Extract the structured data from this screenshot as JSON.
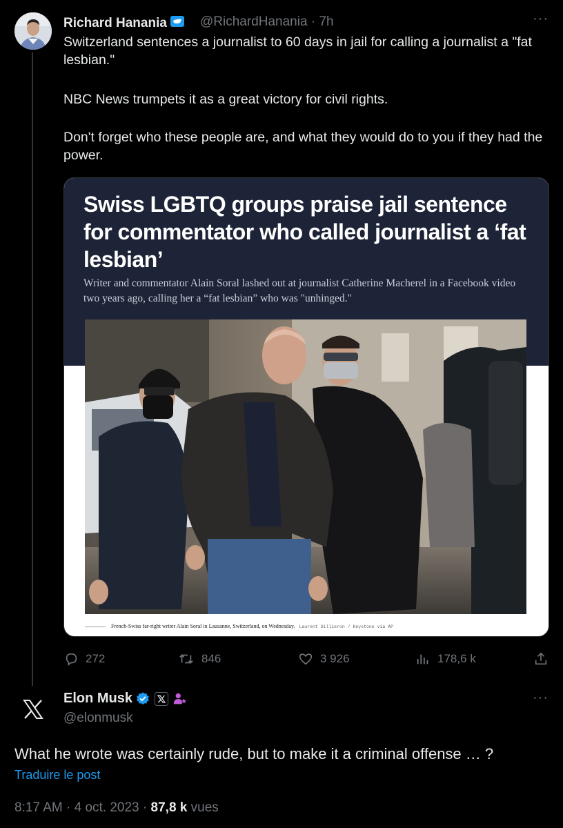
{
  "tweet": {
    "author_name": "Richard Hanania",
    "author_handle": "@RichardHanania",
    "separator": "·",
    "age": "7h",
    "more": "···",
    "text_line1": "Switzerland sentences a journalist to 60 days in jail for calling a journalist a \"fat lesbian.\"",
    "text_line2": "NBC News trumpets it as a great victory for civil rights.",
    "text_line3": "Don't forget who these people are, and what they would do to you if they had the power.",
    "card": {
      "headline": "Swiss LGBTQ groups praise jail sentence for commentator who called journalist a ‘fat lesbian’",
      "dek": "Writer and commentator Alain Soral lashed out at journalist Catherine Macherel in a Facebook video two years ago, calling her a “fat lesbian” who was \"unhinged.\"",
      "caption": "French-Swiss far-right writer Alain Soral in Lausanne, Switzerland, on Wednesday.",
      "credit": "Laurent Gillieron / Keystone via AP"
    },
    "stats": {
      "replies": "272",
      "retweets": "846",
      "likes": "3 926",
      "views": "178,6 k"
    }
  },
  "reply": {
    "author_name": "Elon Musk",
    "author_handle": "@elonmusk",
    "more": "···",
    "text": "What he wrote was certainly rude, but to make it a criminal offense … ?",
    "translate_label": "Traduire le post",
    "time": "8:17 AM",
    "date": "4 oct. 2023",
    "dot": "·",
    "views_count": "87,8 k",
    "views_label": "vues"
  },
  "colors": {
    "background": "#000000",
    "text": "#e7e9ea",
    "muted": "#71767b",
    "accent": "#1d9bf0",
    "card_header": "#1e2437"
  },
  "icons": [
    "verified-badge-icon",
    "more-icon",
    "reply-icon",
    "retweet-icon",
    "like-icon",
    "views-icon",
    "share-icon",
    "x-logo-icon",
    "affiliate-badge-icon",
    "profile-badge-icon"
  ]
}
